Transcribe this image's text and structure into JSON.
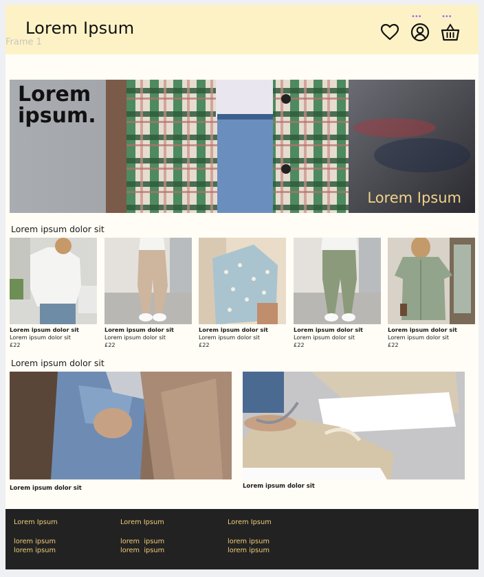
{
  "frame_label": "Frame 1",
  "header": {
    "logo": "Lorem Ipsum",
    "icons": [
      "heart-icon",
      "user-icon",
      "basket-icon"
    ],
    "bg_color": "#fdf2c6"
  },
  "hero": {
    "title": "Lorem\nipsum.",
    "subtitle": "Lorem Ipsum"
  },
  "section1": {
    "title": "Lorem ipsum dolor sit",
    "products": [
      {
        "name": "Lorem ipsum dolor sit",
        "desc": "Lorem ipsum dolor sit",
        "price": "£22"
      },
      {
        "name": "Lorem ipsum dolor sit",
        "desc": "Lorem ipsum dolor sit",
        "price": "£22"
      },
      {
        "name": "Lorem ipsum dolor sit",
        "desc": "Lorem ipsum dolor sit",
        "price": "£22"
      },
      {
        "name": "Lorem ipsum dolor sit",
        "desc": "Lorem ipsum dolor sit",
        "price": "£22"
      },
      {
        "name": "Lorem ipsum dolor sit",
        "desc": "Lorem ipsum dolor sit",
        "price": "£22"
      }
    ]
  },
  "section2": {
    "title": "Lorem ipsum dolor sit",
    "features": [
      {
        "caption": "Lorem ipsum dolor sit"
      },
      {
        "caption": "Lorem ipsum dolor sit"
      }
    ]
  },
  "footer": {
    "columns": [
      {
        "heading": "Lorem Ipsum",
        "links": [
          "lorem ipsum",
          "lorem ipsum"
        ]
      },
      {
        "heading": "Lorem Ipsum",
        "links": [
          "lorem  ipsum",
          "lorem  ipsum"
        ]
      },
      {
        "heading": "Lorem Ipsum",
        "links": [
          "lorem ipsum",
          "lorem ipsum"
        ]
      }
    ],
    "bg_color": "#222222",
    "text_color": "#f1cd78"
  }
}
